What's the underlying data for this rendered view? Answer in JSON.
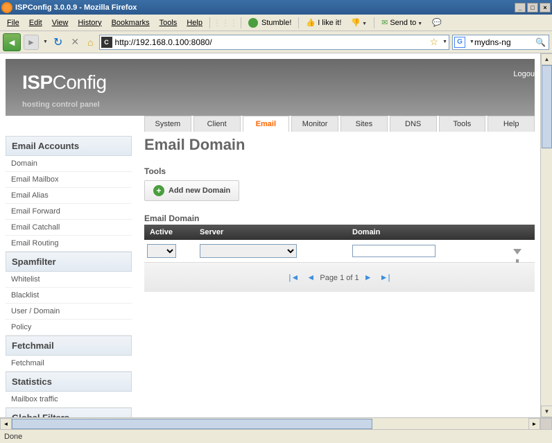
{
  "window": {
    "title": "ISPConfig 3.0.0.9 - Mozilla Firefox"
  },
  "menubar": {
    "file": "File",
    "edit": "Edit",
    "view": "View",
    "history": "History",
    "bookmarks": "Bookmarks",
    "tools": "Tools",
    "help": "Help",
    "stumble": "Stumble!",
    "like": "I like it!",
    "sendto": "Send to"
  },
  "toolbar": {
    "url": "http://192.168.0.100:8080/",
    "search": "mydns-ng"
  },
  "header": {
    "logo1": "ISP",
    "logo2": "Config",
    "tagline": "hosting control panel",
    "logout": "Logou"
  },
  "tabs": [
    "System",
    "Client",
    "Email",
    "Monitor",
    "Sites",
    "DNS",
    "Tools",
    "Help"
  ],
  "active_tab": "Email",
  "sidebar": [
    {
      "title": "Email Accounts",
      "items": [
        "Domain",
        "Email Mailbox",
        "Email Alias",
        "Email Forward",
        "Email Catchall",
        "Email Routing"
      ]
    },
    {
      "title": "Spamfilter",
      "items": [
        "Whitelist",
        "Blacklist",
        "User / Domain",
        "Policy"
      ]
    },
    {
      "title": "Fetchmail",
      "items": [
        "Fetchmail"
      ]
    },
    {
      "title": "Statistics",
      "items": [
        "Mailbox traffic"
      ]
    },
    {
      "title": "Global Filters",
      "items": []
    }
  ],
  "content": {
    "title": "Email Domain",
    "tools_label": "Tools",
    "add_button": "Add new Domain",
    "section_label": "Email Domain",
    "columns": {
      "active": "Active",
      "server": "Server",
      "domain": "Domain"
    },
    "pagination": "Page 1 of 1"
  },
  "statusbar": {
    "text": "Done"
  }
}
